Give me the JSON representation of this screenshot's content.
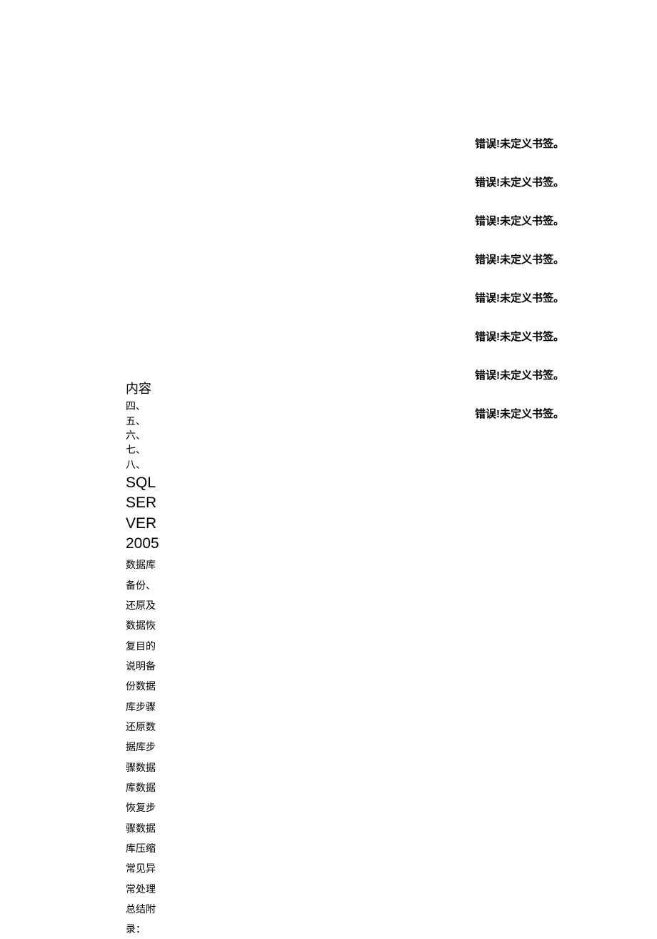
{
  "errors": [
    "错误!未定义书签。",
    "错误!未定义书签。",
    "错误!未定义书签。",
    "错误!未定义书签。",
    "错误!未定义书签。",
    "错误!未定义书签。",
    "错误!未定义书签。",
    "错误!未定义书签。"
  ],
  "content": {
    "heading": "内容",
    "subnumbers": "四、五、六、七、八、",
    "title_part1": "SQL SERVER 2005",
    "body": "数据库备份、还原及数据恢复目的说明备份数据库步骤还原数据库步骤数据库数据恢复步骤数据库压缩常见异常处理总结附录："
  }
}
